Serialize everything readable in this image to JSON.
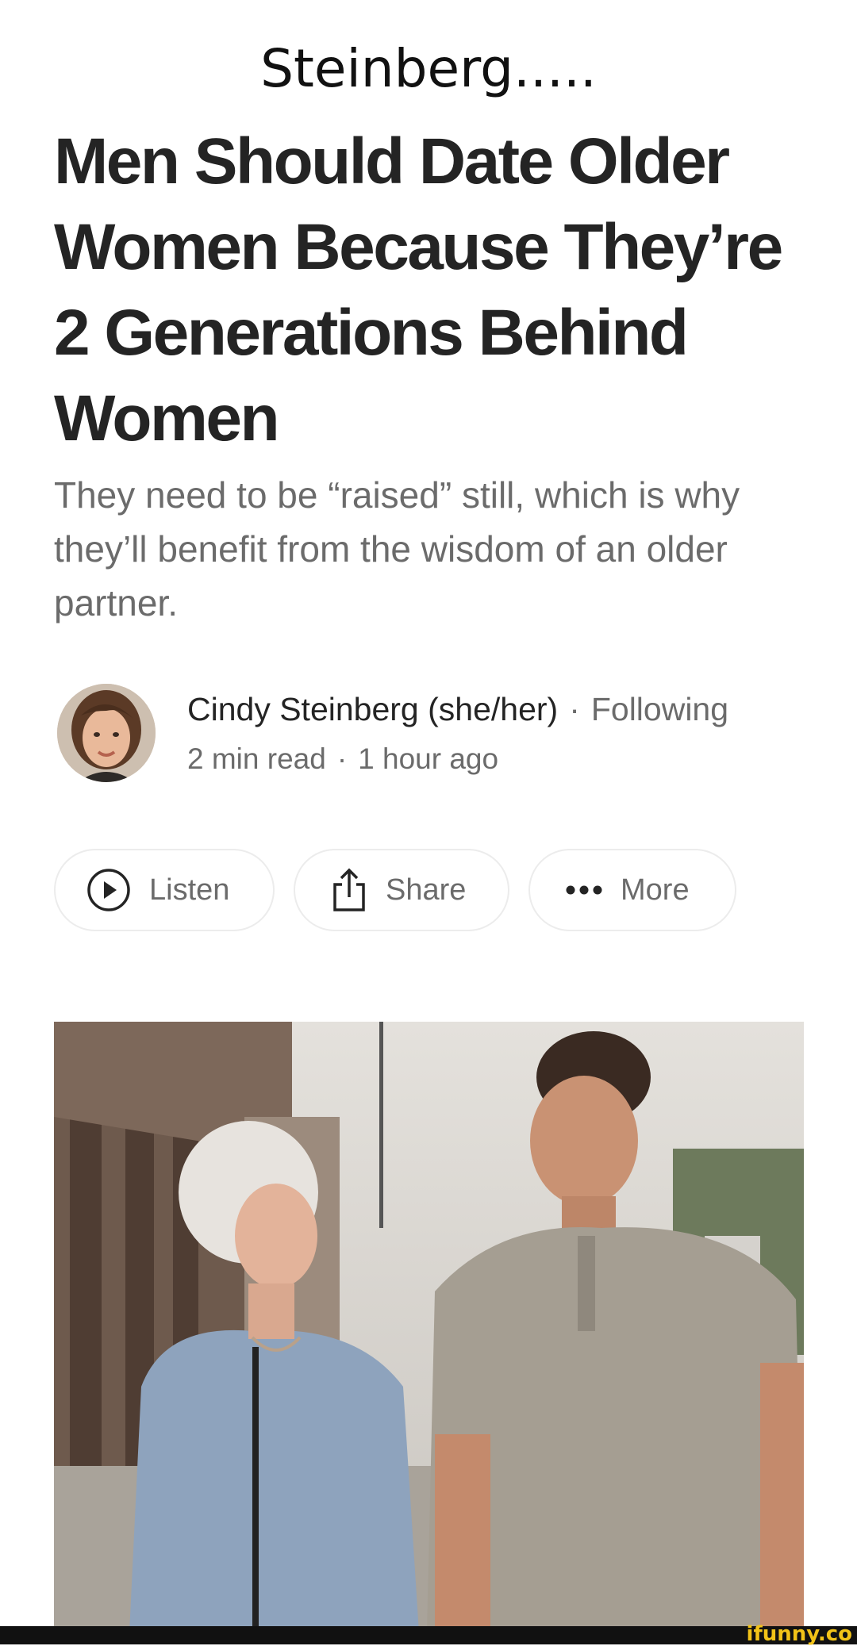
{
  "caption": "Steinberg.....",
  "article": {
    "title": "Men Should Date Older Women Because They’re 2 Generations Behind Women",
    "subtitle": "They need to be “raised” still, which is why they’ll benefit from the wisdom of an older partner."
  },
  "author": {
    "name": "Cindy Steinberg (she/her)",
    "separator": "·",
    "follow_label": "Following",
    "read_time": "2 min read",
    "published": "1 hour ago"
  },
  "actions": {
    "listen_label": "Listen",
    "share_label": "Share",
    "more_label": "More"
  },
  "icons": {
    "listen": "play-circle-icon",
    "share": "share-icon",
    "more": "more-dots-icon"
  },
  "watermark": "ifunny.co",
  "colors": {
    "text": "#242424",
    "muted": "#6b6b6b",
    "pill_border": "#ececec",
    "watermark": "#f2c318"
  }
}
